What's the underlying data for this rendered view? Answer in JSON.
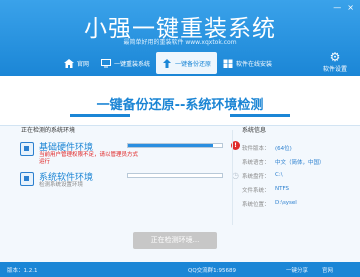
{
  "app": {
    "title": "小强一键重装系统",
    "subtitle": "最简单好用的重装软件  www.xqxtok.com"
  },
  "window_controls": {
    "minimize": "—",
    "close": "×"
  },
  "nav": {
    "items": [
      {
        "label": "官网",
        "active": false
      },
      {
        "label": "一键重装系统",
        "active": false
      },
      {
        "label": "一键备份还原",
        "active": true
      },
      {
        "label": "软件在线安装",
        "active": false
      }
    ],
    "settings_label": "软件设置"
  },
  "banner": {
    "title": "一键备份还原--系统环境检测"
  },
  "checking": {
    "header": "正在检测的系统环境",
    "items": [
      {
        "name": "基础硬件环境",
        "desc": "当前用户管理权限不足，请以管理员方式运行",
        "progress": 0.9,
        "status": "error",
        "status_glyph": "!"
      },
      {
        "name": "系统软件环境",
        "desc": "检测系统设置环境",
        "progress": 0,
        "status": "pending",
        "status_glyph": "◷"
      }
    ]
  },
  "sysinfo": {
    "header": "系统信息",
    "rows": [
      {
        "label": "软件版本：",
        "value": "(64位)"
      },
      {
        "label": "系统语言：",
        "value": "中文（简体，中国）"
      },
      {
        "label": "系统盘符：",
        "value": "C:\\"
      },
      {
        "label": "文件系统：",
        "value": "NTFS"
      },
      {
        "label": "系统位置：",
        "value": "D:\\sysel"
      }
    ]
  },
  "button": {
    "label": "正在检测环境..."
  },
  "footer": {
    "version": "版本：1.2.1",
    "qq": "QQ交流群1:95689",
    "share": "一键分享",
    "site": "官网"
  },
  "colors": {
    "primary": "#1b86d6",
    "error": "#e02020",
    "button_disabled": "#c7c7c7"
  }
}
